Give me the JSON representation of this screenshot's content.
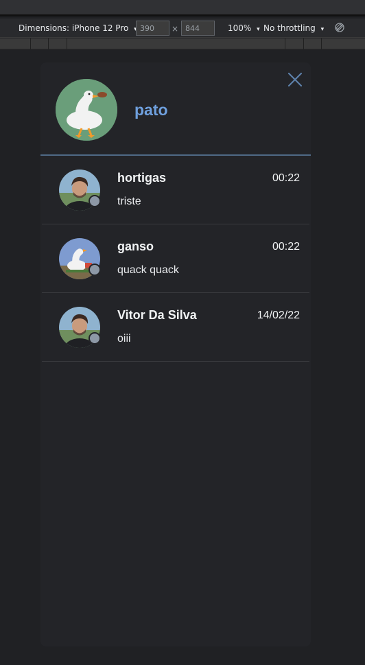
{
  "devtools": {
    "dimensions_label": "Dimensions: iPhone 12 Pro",
    "width_value": "390",
    "height_value": "844",
    "times_symbol": "×",
    "zoom": "100%",
    "throttling": "No throttling",
    "caret": "▾"
  },
  "profile": {
    "name": "pato",
    "avatar": "goose-avatar",
    "close_icon": "close-icon"
  },
  "conversations": [
    {
      "name": "hortigas",
      "time": "00:22",
      "message": "triste",
      "avatar": "man-avatar",
      "status_color": "#8d98a6"
    },
    {
      "name": "ganso",
      "time": "00:22",
      "message": "quack quack",
      "avatar": "goose-avatar",
      "status_color": "#8d98a6"
    },
    {
      "name": "Vitor Da Silva",
      "time": "14/02/22",
      "message": "oiii",
      "avatar": "man-avatar",
      "status_color": "#8d98a6"
    }
  ],
  "colors": {
    "accent": "#6fa0de",
    "divider": "#4f6a86",
    "panel": "#232428",
    "background": "#202124"
  }
}
